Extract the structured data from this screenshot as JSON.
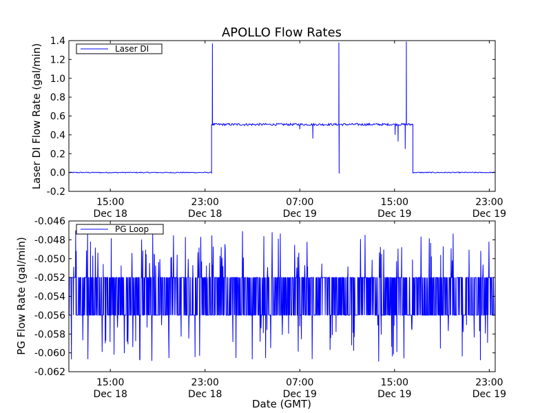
{
  "chart_data": [
    {
      "type": "line",
      "title": "APOLLO Flow Rates",
      "xlabel": "",
      "ylabel": "Laser DI Flow Rate (gal/min)",
      "ylim": [
        -0.2,
        1.4
      ],
      "yticks": [
        "-0.2",
        "0.0",
        "0.2",
        "0.4",
        "0.6",
        "0.8",
        "1.0",
        "1.2",
        "1.4"
      ],
      "xticks": [
        {
          "time": "15:00",
          "date": "Dec 18"
        },
        {
          "time": "23:00",
          "date": "Dec 18"
        },
        {
          "time": "07:00",
          "date": "Dec 19"
        },
        {
          "time": "15:00",
          "date": "Dec 19"
        },
        {
          "time": "23:00",
          "date": "Dec 19"
        }
      ],
      "xlim_hours": [
        11.5,
        47.5
      ],
      "grid": false,
      "legend_position": "top-left",
      "series": [
        {
          "name": "Laser DI",
          "color": "#0000ff",
          "segments": [
            {
              "from_hour": 11.5,
              "to_hour": 23.55,
              "mean": 0.0,
              "noise": 0.005
            },
            {
              "from_hour": 23.55,
              "to_hour": 40.55,
              "mean": 0.51,
              "noise": 0.012
            },
            {
              "from_hour": 40.55,
              "to_hour": 47.5,
              "mean": 0.0,
              "noise": 0.005
            }
          ],
          "spikes": [
            {
              "hour": 23.62,
              "value": 1.37
            },
            {
              "hour": 34.3,
              "value": 1.38
            },
            {
              "hour": 34.32,
              "value": -0.01
            },
            {
              "hour": 40.0,
              "value": 1.39
            },
            {
              "hour": 39.9,
              "value": 0.25
            },
            {
              "hour": 39.3,
              "value": 0.33
            },
            {
              "hour": 39.05,
              "value": 0.4
            },
            {
              "hour": 32.1,
              "value": 0.36
            },
            {
              "hour": 31.0,
              "value": 0.46
            }
          ]
        }
      ]
    },
    {
      "type": "line",
      "title": "",
      "xlabel": "Date (GMT)",
      "ylabel": "PG Flow Rate (gal/min)",
      "ylim": [
        -0.062,
        -0.046
      ],
      "yticks": [
        "-0.062",
        "-0.060",
        "-0.058",
        "-0.056",
        "-0.054",
        "-0.052",
        "-0.050",
        "-0.048",
        "-0.046"
      ],
      "xticks": [
        {
          "time": "15:00",
          "date": "Dec 18"
        },
        {
          "time": "23:00",
          "date": "Dec 18"
        },
        {
          "time": "07:00",
          "date": "Dec 19"
        },
        {
          "time": "15:00",
          "date": "Dec 19"
        },
        {
          "time": "23:00",
          "date": "Dec 19"
        }
      ],
      "xlim_hours": [
        11.5,
        47.5
      ],
      "grid": false,
      "legend_position": "top-left",
      "series": [
        {
          "name": "PG Loop",
          "color": "#0000ff",
          "mean": -0.054,
          "band": [
            -0.056,
            -0.052
          ],
          "extreme_range": [
            -0.061,
            -0.047
          ]
        }
      ]
    }
  ]
}
